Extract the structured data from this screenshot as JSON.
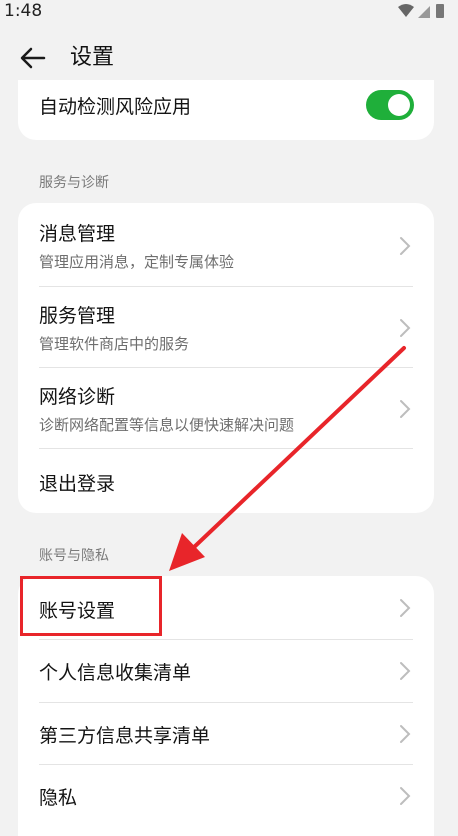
{
  "status_bar": {
    "time": "1:48"
  },
  "header": {
    "title": "设置"
  },
  "top_item": {
    "label": "自动检测风险应用",
    "toggle_on": true
  },
  "sections": {
    "service": {
      "label": "服务与诊断",
      "items": [
        {
          "title": "消息管理",
          "subtitle": "管理应用消息，定制专属体验"
        },
        {
          "title": "服务管理",
          "subtitle": "管理软件商店中的服务"
        },
        {
          "title": "网络诊断",
          "subtitle": "诊断网络配置等信息以便快速解决问题"
        },
        {
          "title": "退出登录"
        }
      ]
    },
    "account": {
      "label": "账号与隐私",
      "items": [
        {
          "title": "账号设置"
        },
        {
          "title": "个人信息收集清单"
        },
        {
          "title": "第三方信息共享清单"
        },
        {
          "title": "隐私"
        }
      ]
    }
  },
  "colors": {
    "toggle_on": "#1faf3a",
    "highlight": "#e8252a",
    "background": "#f2f2f2"
  }
}
